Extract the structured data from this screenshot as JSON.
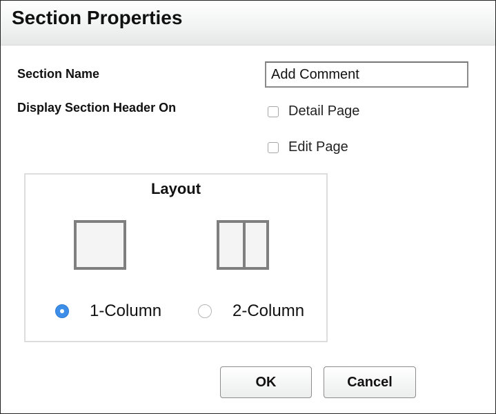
{
  "dialog": {
    "title": "Section Properties"
  },
  "form": {
    "section_name_label": "Section Name",
    "section_name_value": "Add Comment",
    "display_header_label": "Display Section Header On",
    "checkboxes": [
      {
        "label": "Detail Page",
        "checked": false
      },
      {
        "label": "Edit Page",
        "checked": false
      }
    ]
  },
  "layout": {
    "title": "Layout",
    "options": [
      {
        "label": "1-Column",
        "selected": true,
        "icon": "one-column-icon"
      },
      {
        "label": "2-Column",
        "selected": false,
        "icon": "two-column-icon"
      }
    ]
  },
  "buttons": {
    "ok_label": "OK",
    "cancel_label": "Cancel"
  },
  "colors": {
    "radio_selected": "#3d8ee8",
    "icon_border": "#7f7f7f"
  }
}
